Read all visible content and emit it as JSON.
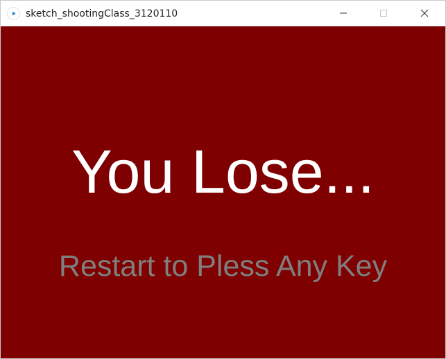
{
  "window": {
    "title": "sketch_shootingClass_3120110",
    "app_icon": "processing-play-icon",
    "controls": {
      "minimize_icon": "minimize-icon",
      "maximize_icon": "maximize-icon",
      "close_icon": "close-icon"
    }
  },
  "canvas": {
    "background_color": "#7f0000",
    "headline": "You Lose...",
    "headline_color": "#ffffff",
    "subline": "Restart to Pless Any Key",
    "subline_color": "#7f7f7f"
  }
}
